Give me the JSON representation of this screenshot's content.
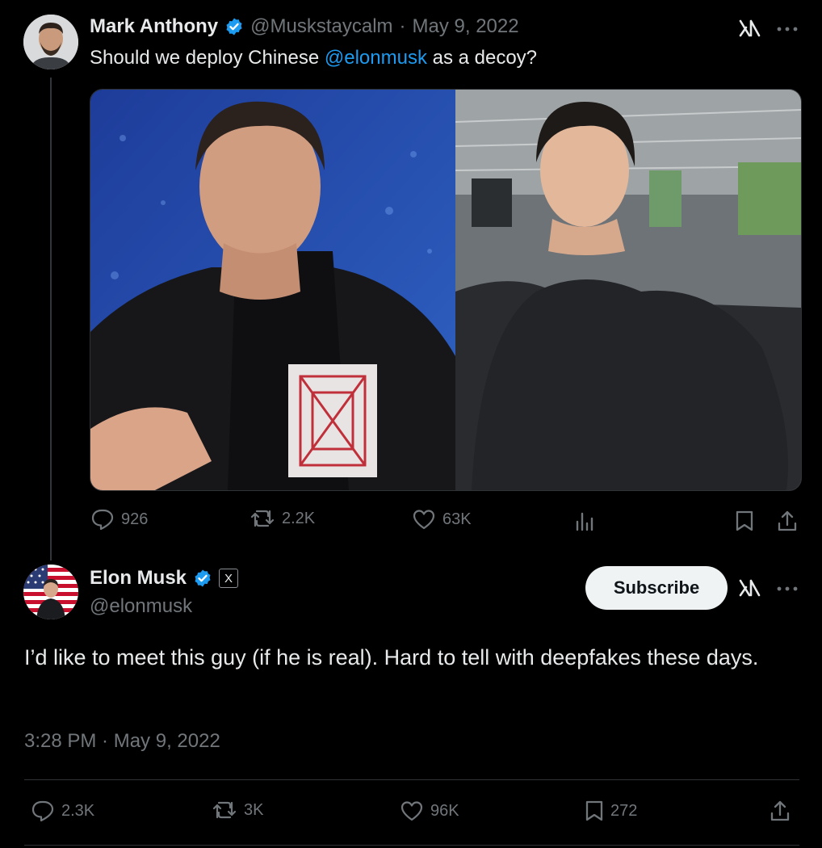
{
  "parent_tweet": {
    "author_name": "Mark Anthony",
    "handle": "@Muskstaycalm",
    "separator": "·",
    "date": "May 9, 2022",
    "text_before": "Should we deploy Chinese ",
    "mention": "@elonmusk",
    "text_after": " as a decoy?",
    "stats": {
      "replies": "926",
      "retweets": "2.2K",
      "likes": "63K"
    }
  },
  "reply_tweet": {
    "author_name": "Elon Musk",
    "handle": "@elonmusk",
    "affiliate_badge": "X",
    "subscribe_label": "Subscribe",
    "text": "I’d like to meet this guy (if he is real). Hard to tell with deepfakes these days.",
    "timestamp": "3:28 PM · May 9, 2022",
    "stats": {
      "replies": "2.3K",
      "retweets": "3K",
      "likes": "96K",
      "bookmarks": "272"
    }
  },
  "colors": {
    "background": "#000000",
    "text": "#e7e9ea",
    "muted": "#71767b",
    "accent": "#1d9bf0",
    "divider": "#2f3336"
  }
}
